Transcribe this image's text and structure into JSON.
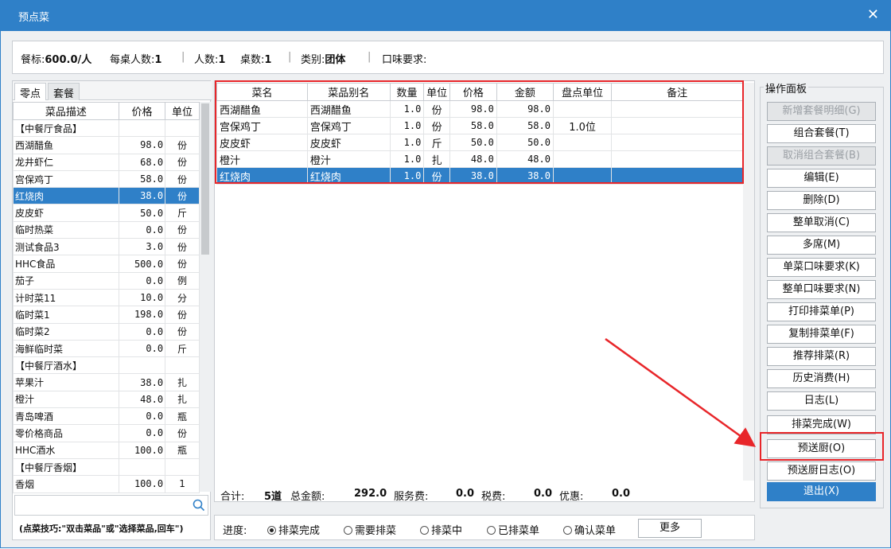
{
  "window": {
    "title": "预点菜",
    "close": "✕"
  },
  "info": {
    "standard_label": "餐标:",
    "standard_value": "600.0/人",
    "per_table_label": "每桌人数:",
    "per_table_value": "1",
    "people_label": "人数:",
    "people_value": "1",
    "tables_label": "桌数:",
    "tables_value": "1",
    "category_label": "类别:",
    "category_value": "团体",
    "taste_label": "口味要求:"
  },
  "left": {
    "tabs": [
      "零点",
      "套餐"
    ],
    "headers": [
      "菜品描述",
      "价格",
      "单位"
    ],
    "rows": [
      {
        "desc": "【中餐厅食品】",
        "price": "",
        "unit": ""
      },
      {
        "desc": "西湖醋鱼",
        "price": "98.0",
        "unit": "份"
      },
      {
        "desc": "龙井虾仁",
        "price": "68.0",
        "unit": "份"
      },
      {
        "desc": "宫保鸡丁",
        "price": "58.0",
        "unit": "份"
      },
      {
        "desc": "红烧肉",
        "price": "38.0",
        "unit": "份"
      },
      {
        "desc": "皮皮虾",
        "price": "50.0",
        "unit": "斤"
      },
      {
        "desc": "临时热菜",
        "price": "0.0",
        "unit": "份"
      },
      {
        "desc": "测试食品3",
        "price": "3.0",
        "unit": "份"
      },
      {
        "desc": "HHC食品",
        "price": "500.0",
        "unit": "份"
      },
      {
        "desc": "茄子",
        "price": "0.0",
        "unit": "例"
      },
      {
        "desc": "计时菜11",
        "price": "10.0",
        "unit": "分"
      },
      {
        "desc": "临时菜1",
        "price": "198.0",
        "unit": "份"
      },
      {
        "desc": "临时菜2",
        "price": "0.0",
        "unit": "份"
      },
      {
        "desc": "海鲜临时菜",
        "price": "0.0",
        "unit": "斤"
      },
      {
        "desc": "【中餐厅酒水】",
        "price": "",
        "unit": ""
      },
      {
        "desc": "苹果汁",
        "price": "38.0",
        "unit": "扎"
      },
      {
        "desc": "橙汁",
        "price": "48.0",
        "unit": "扎"
      },
      {
        "desc": "青岛啤酒",
        "price": "0.0",
        "unit": "瓶"
      },
      {
        "desc": "零价格商品",
        "price": "0.0",
        "unit": "份"
      },
      {
        "desc": "HHC酒水",
        "price": "100.0",
        "unit": "瓶"
      },
      {
        "desc": "【中餐厅香烟】",
        "price": "",
        "unit": ""
      },
      {
        "desc": "香烟",
        "price": "100.0",
        "unit": "1"
      }
    ],
    "selected_row": 4,
    "search_placeholder": "",
    "tip": "(点菜技巧:\"双击菜品\"或\"选择菜品,回车\")"
  },
  "order": {
    "headers": [
      "菜名",
      "菜品别名",
      "数量",
      "单位",
      "价格",
      "金额",
      "盘点单位",
      "备注"
    ],
    "rows": [
      {
        "name": "西湖醋鱼",
        "alias": "西湖醋鱼",
        "qty": "1.0",
        "unit": "份",
        "price": "98.0",
        "amount": "98.0",
        "count_unit": "",
        "note": ""
      },
      {
        "name": "宫保鸡丁",
        "alias": "宫保鸡丁",
        "qty": "1.0",
        "unit": "份",
        "price": "58.0",
        "amount": "58.0",
        "count_unit": "1.0位",
        "note": ""
      },
      {
        "name": "皮皮虾",
        "alias": "皮皮虾",
        "qty": "1.0",
        "unit": "斤",
        "price": "50.0",
        "amount": "50.0",
        "count_unit": "",
        "note": ""
      },
      {
        "name": "橙汁",
        "alias": "橙汁",
        "qty": "1.0",
        "unit": "扎",
        "price": "48.0",
        "amount": "48.0",
        "count_unit": "",
        "note": ""
      },
      {
        "name": "红烧肉",
        "alias": "红烧肉",
        "qty": "1.0",
        "unit": "份",
        "price": "38.0",
        "amount": "38.0",
        "count_unit": "",
        "note": ""
      }
    ],
    "selected_row": 4
  },
  "totals": {
    "total_label": "合计:",
    "total_value": "5道",
    "sum_label": "总金额:",
    "sum_value": "292.0",
    "service_label": "服务费:",
    "service_value": "0.0",
    "tax_label": "税费:",
    "tax_value": "0.0",
    "discount_label": "优惠:",
    "discount_value": "0.0"
  },
  "progress": {
    "label": "进度:",
    "options": [
      "排菜完成",
      "需要排菜",
      "排菜中",
      "已排菜单",
      "确认菜单"
    ],
    "selected": 0,
    "more": "更多"
  },
  "ops": {
    "legend": "操作面板",
    "buttons": [
      {
        "label": "新增套餐明细(G)",
        "state": "disabled"
      },
      {
        "label": "组合套餐(T)",
        "state": "normal"
      },
      {
        "label": "取消组合套餐(B)",
        "state": "disabled"
      },
      {
        "label": "编辑(E)",
        "state": "normal"
      },
      {
        "label": "删除(D)",
        "state": "normal"
      },
      {
        "label": "整单取消(C)",
        "state": "normal"
      },
      {
        "label": "多席(M)",
        "state": "normal"
      },
      {
        "label": "单菜口味要求(K)",
        "state": "normal"
      },
      {
        "label": "整单口味要求(N)",
        "state": "normal"
      },
      {
        "label": "打印排菜单(P)",
        "state": "normal"
      },
      {
        "label": "复制排菜单(F)",
        "state": "normal"
      },
      {
        "label": "推荐排菜(R)",
        "state": "normal"
      },
      {
        "label": "历史消费(H)",
        "state": "normal"
      },
      {
        "label": "日志(L)",
        "state": "normal"
      },
      {
        "label": "排菜完成(W)",
        "state": "normal"
      },
      {
        "label": "预送厨(O)",
        "state": "highlighted"
      },
      {
        "label": "预送厨日志(O)",
        "state": "normal"
      },
      {
        "label": "退出(X)",
        "state": "primary"
      }
    ]
  },
  "colors": {
    "accent": "#2f80c8",
    "annotation": "#e8262a"
  }
}
